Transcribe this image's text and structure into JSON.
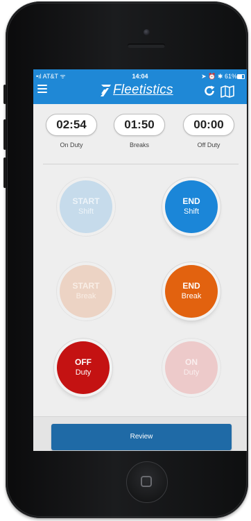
{
  "status_bar": {
    "carrier": "AT&T",
    "time": "14:04",
    "battery": "61%"
  },
  "header": {
    "brand": "Fleetistics",
    "icons": [
      "menu-icon",
      "refresh-icon",
      "map-icon"
    ]
  },
  "timers": [
    {
      "value": "02:54",
      "label": "On Duty"
    },
    {
      "value": "01:50",
      "label": "Breaks"
    },
    {
      "value": "00:00",
      "label": "Off Duty"
    }
  ],
  "buttons": {
    "start_shift": {
      "line1": "START",
      "line2": "Shift",
      "state": "disabled"
    },
    "end_shift": {
      "line1": "END",
      "line2": "Shift",
      "state": "active"
    },
    "start_break": {
      "line1": "START",
      "line2": "Break",
      "state": "disabled"
    },
    "end_break": {
      "line1": "END",
      "line2": "Break",
      "state": "active"
    },
    "off_duty": {
      "line1": "OFF",
      "line2": "Duty",
      "state": "active"
    },
    "on_duty": {
      "line1": "ON",
      "line2": "Duty",
      "state": "disabled"
    }
  },
  "footer": {
    "review_label": "Review"
  },
  "colors": {
    "header_blue": "#1f88d6",
    "end_shift_blue": "#1b86d8",
    "end_break_orange": "#e2620f",
    "off_duty_red": "#c41212",
    "review_blue": "#1f6aa6"
  }
}
